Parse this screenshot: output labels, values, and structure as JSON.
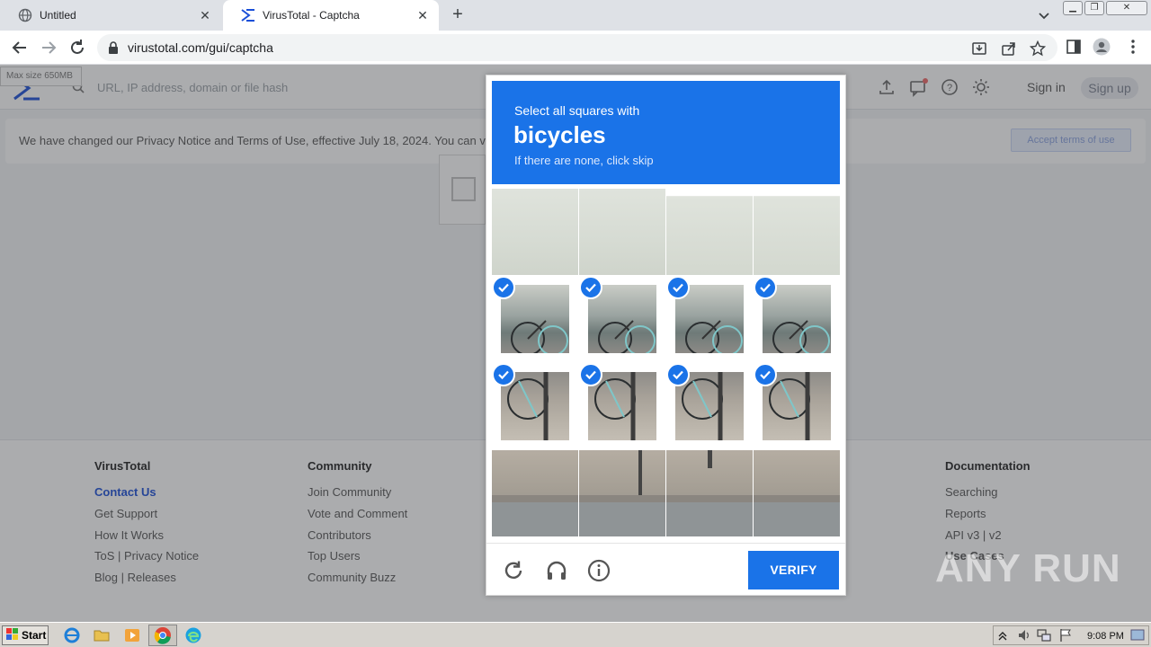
{
  "browser": {
    "tabs": [
      {
        "title": "Untitled"
      },
      {
        "title": "VirusTotal - Captcha"
      }
    ],
    "url": "virustotal.com/gui/captcha"
  },
  "page": {
    "search_placeholder": "URL, IP address, domain or file hash",
    "max_size": "Max size 650MB",
    "sign_in": "Sign in",
    "sign_up": "Sign up",
    "notice_text": "We have changed our Privacy Notice and Terms of Use, effective July 18, 2024. You can v",
    "accept_button": "Accept terms of use"
  },
  "footer": {
    "virustotal": {
      "heading": "VirusTotal",
      "links": [
        "Contact Us",
        "Get Support",
        "How It Works",
        "ToS | Privacy Notice",
        "Blog | Releases"
      ]
    },
    "community": {
      "heading": "Community",
      "links": [
        "Join Community",
        "Vote and Comment",
        "Contributors",
        "Top Users",
        "Community Buzz"
      ]
    },
    "documentation": {
      "heading": "Documentation",
      "links": [
        "Searching",
        "Reports",
        "API v3 | v2",
        "Use Cases"
      ]
    }
  },
  "captcha": {
    "prompt_line1": "Select all squares with",
    "target": "bicycles",
    "prompt_line3": "If there are none, click skip",
    "verify_label": "VERIFY",
    "selected_rows": [
      1,
      2
    ],
    "accent_color": "#1a73e8"
  },
  "watermark": "ANY RUN",
  "taskbar": {
    "start_label": "Start",
    "clock": "9:08 PM"
  }
}
